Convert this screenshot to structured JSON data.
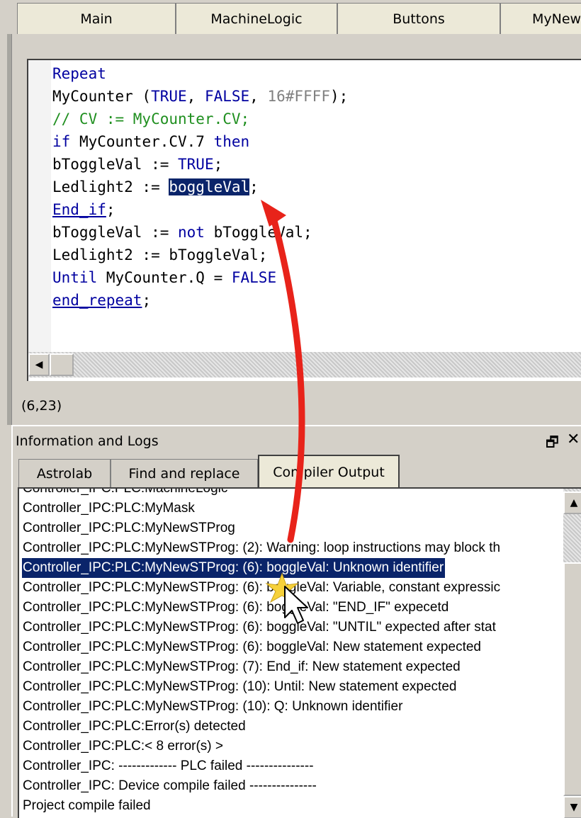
{
  "editor_tabs": [
    {
      "label": "Main"
    },
    {
      "label": "MachineLogic"
    },
    {
      "label": "Buttons"
    },
    {
      "label": "MyNew"
    }
  ],
  "code": {
    "line1": "Repeat",
    "line2_a": "MyCounter (",
    "line2_true": "TRUE",
    "line2_sep": ", ",
    "line2_false": "FALSE",
    "line2_sep2": ", ",
    "line2_num": "16#FFFF",
    "line2_end": ");",
    "line3": "// CV := MyCounter.CV;",
    "line4_if": "if",
    "line4_mid": " MyCounter.CV.7 ",
    "line4_then": "then",
    "line5_a": "bToggleVal := ",
    "line5_true": "TRUE",
    "line5_end": ";",
    "line6_a": "Ledlight2 := ",
    "line6_sel": "boggleVal",
    "line6_end": ";",
    "line7_kw": "End_if",
    "line7_end": ";",
    "line8_a": "bToggleVal := ",
    "line8_not": "not",
    "line8_b": " bToggleVal;",
    "line9": "Ledlight2 := bToggleVal;",
    "line10_until": "Until",
    "line10_mid": " MyCounter.Q = ",
    "line10_false": "FALSE",
    "line11_kw": "end_repeat",
    "line11_end": ";"
  },
  "status": {
    "cursor_position": "(6,23)"
  },
  "info_panel": {
    "title": "Information and Logs",
    "pin_icon_glyph": "🗗",
    "close_icon_glyph": "✕",
    "tabs": [
      {
        "label": "Astrolab"
      },
      {
        "label": "Find and replace"
      },
      {
        "label": "Compiler Output"
      }
    ],
    "active_tab": "Compiler Output"
  },
  "compiler_output": [
    "Controller_IPC:PLC:MachineLogic",
    "Controller_IPC:PLC:MyMask",
    "Controller_IPC:PLC:MyNewSTProg",
    "Controller_IPC:PLC:MyNewSTProg: (2): Warning: loop instructions may block th",
    "Controller_IPC:PLC:MyNewSTProg: (6): boggleVal: Unknown identifier",
    "Controller_IPC:PLC:MyNewSTProg: (6): boggleVal: Variable, constant expressic",
    "Controller_IPC:PLC:MyNewSTProg: (6): boggleVal: \"END_IF\" expecetd",
    "Controller_IPC:PLC:MyNewSTProg: (6): boggleVal: \"UNTIL\" expected after stat",
    "Controller_IPC:PLC:MyNewSTProg: (6): boggleVal: New statement expected",
    "Controller_IPC:PLC:MyNewSTProg: (7): End_if: New statement expected",
    "Controller_IPC:PLC:MyNewSTProg: (10): Until: New statement expected",
    "Controller_IPC:PLC:MyNewSTProg: (10): Q: Unknown identifier",
    "Controller_IPC:PLC:Error(s) detected",
    "Controller_IPC:PLC:< 8 error(s) >",
    "Controller_IPC: ------------- PLC failed ---------------",
    "Controller_IPC:  Device compile  failed ---------------",
    "Project compile failed"
  ],
  "highlighted_output_index": 4,
  "scroll_glyphs": {
    "left": "◀",
    "up": "▲",
    "down": "▼"
  },
  "colors": {
    "keyword": "#0000a0",
    "comment": "#1f8f1f",
    "selection": "#0a246a",
    "annotation_arrow": "#e8231a"
  }
}
